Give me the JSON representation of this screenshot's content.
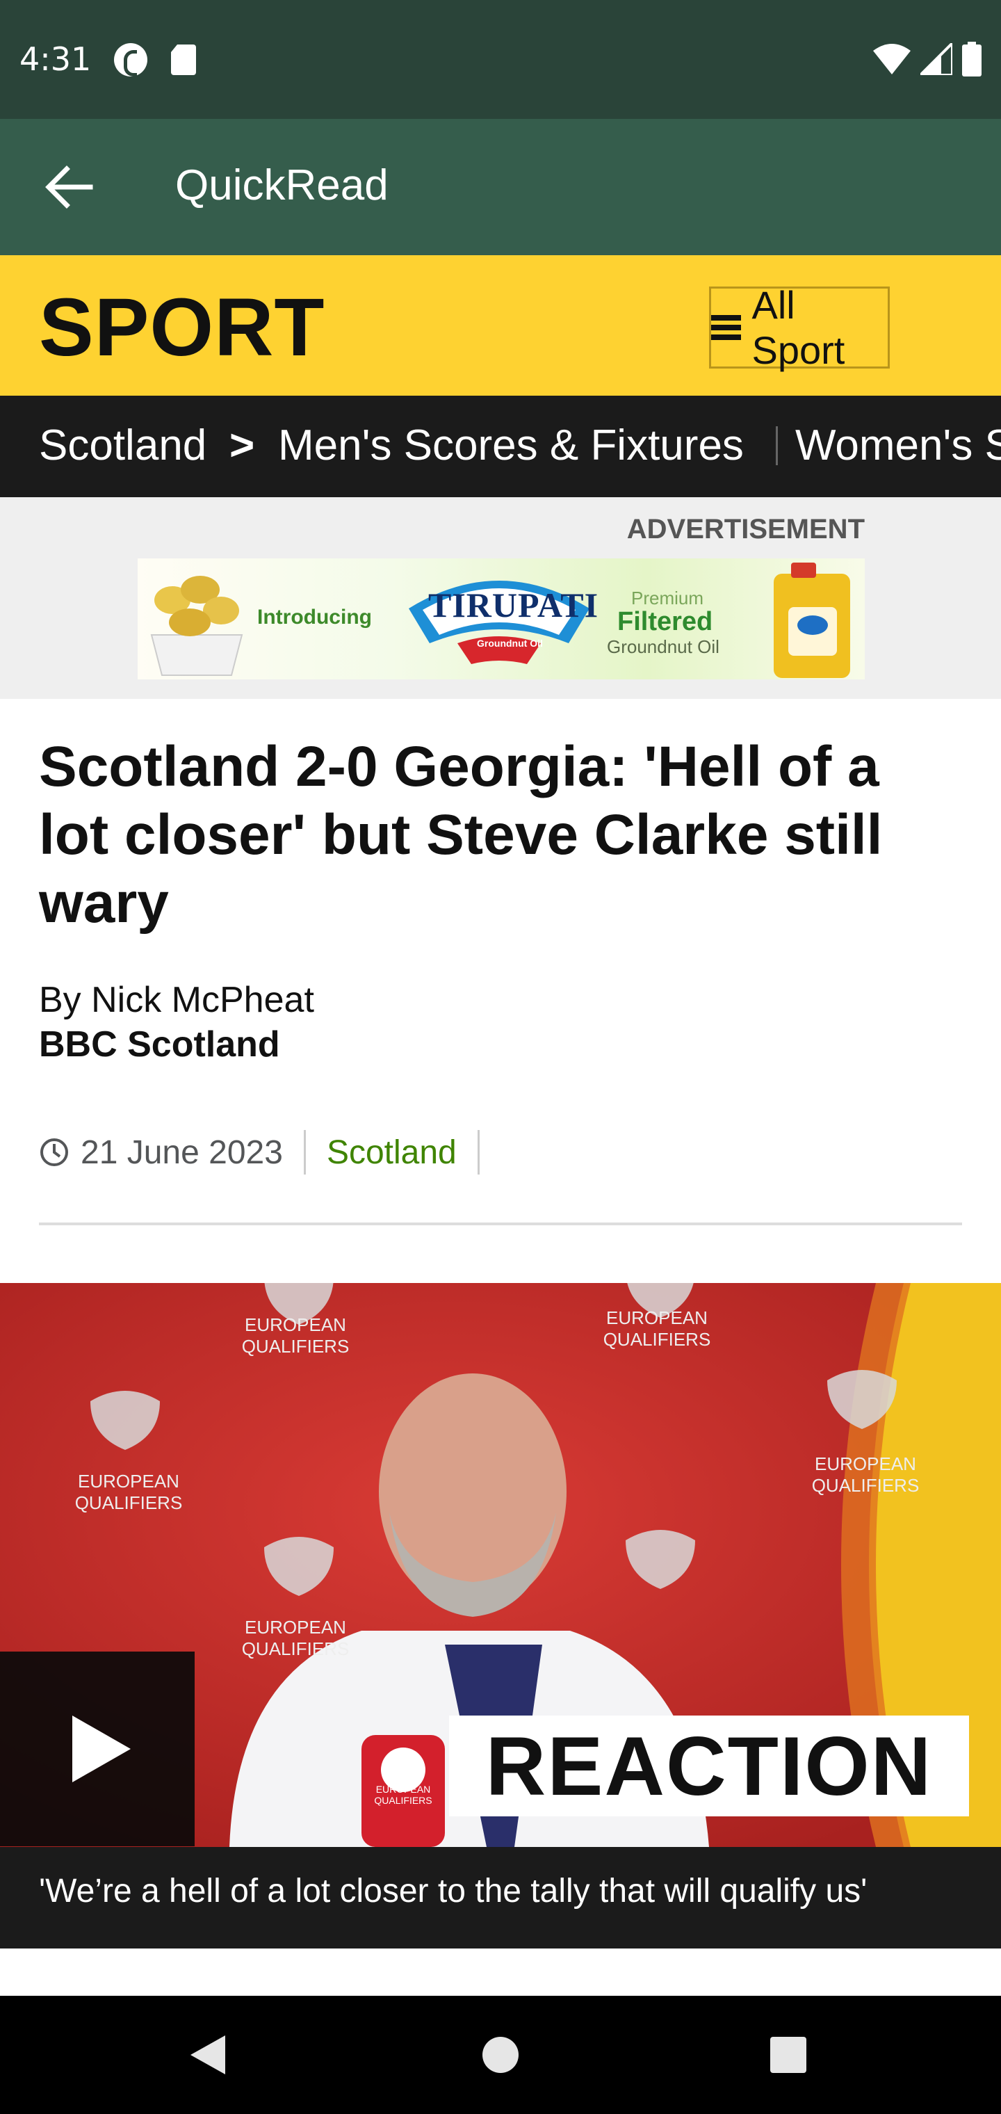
{
  "status_bar": {
    "time": "4:31",
    "icons": [
      "c-badge-icon",
      "sd-card-icon",
      "wifi-icon",
      "signal-icon",
      "battery-icon"
    ]
  },
  "app_bar": {
    "title": "QuickRead",
    "back_icon": "arrow-back-icon"
  },
  "sport_header": {
    "logo": "SPORT",
    "all_sport_label": "All Sport",
    "background": "#fed231"
  },
  "nav": {
    "current": "Scotland",
    "separator": ">",
    "items": [
      "Men's Scores & Fixtures",
      "Women's S"
    ]
  },
  "ad": {
    "label": "ADVERTISEMENT",
    "introducing": "Introducing",
    "brand": "TIRUPATI",
    "brand_sub": "Groundnut Oil",
    "premium": "Premium",
    "filtered": "Filtered",
    "groundnut": "Groundnut Oil"
  },
  "article": {
    "headline": "Scotland 2-0 Georgia: 'Hell of a lot closer' but Steve Clarke still wary",
    "byline": "By Nick McPheat",
    "byline_org": "BBC Scotland",
    "date": "21 June 2023",
    "topic": "Scotland"
  },
  "media": {
    "badge_text": "REACTION",
    "backdrop_text": "EUROPEAN QUALIFIERS",
    "mic_text": "EUROPEAN QUALIFIERS",
    "caption": "'We’re a hell of a lot closer to the tally that will qualify us'"
  },
  "colors": {
    "status_bar": "#2a4439",
    "app_bar": "#355d4c",
    "nav_strip": "#1b1b1b",
    "topic_link": "#3f8400",
    "media_red": "#c72c2a"
  },
  "system_nav": [
    "back-triangle-icon",
    "home-circle-icon",
    "recents-square-icon"
  ]
}
